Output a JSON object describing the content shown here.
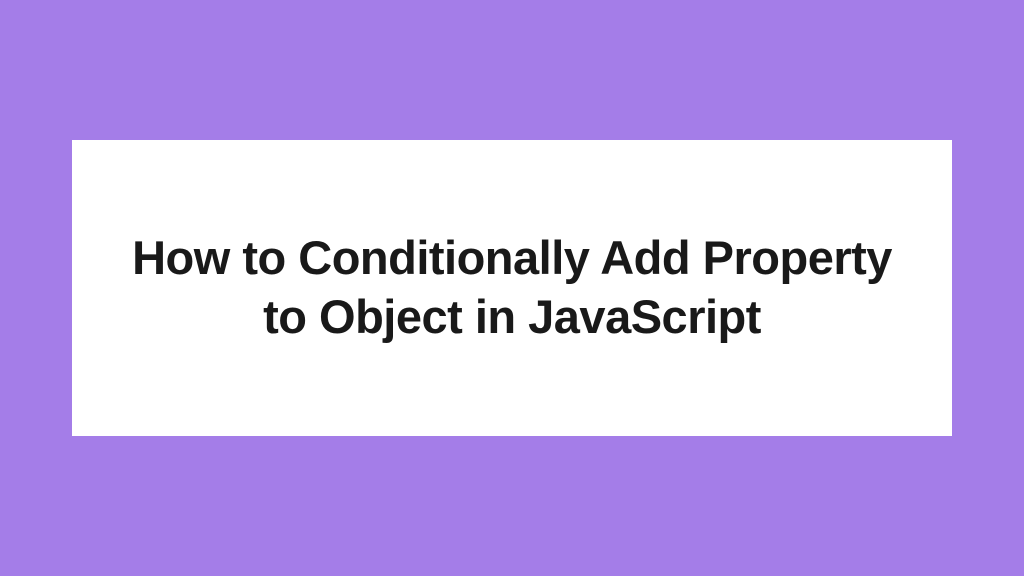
{
  "card": {
    "title": "How to Conditionally Add Property to Object in JavaScript"
  },
  "colors": {
    "background": "#a47de8",
    "cardBackground": "#ffffff",
    "textColor": "#191919"
  }
}
